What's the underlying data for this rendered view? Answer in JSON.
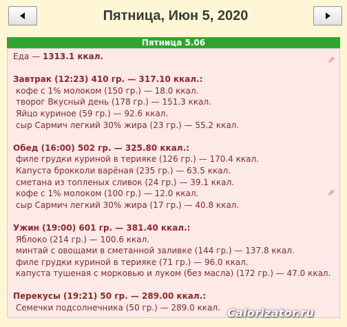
{
  "header": {
    "prev_icon": "left-arrow-icon",
    "next_icon": "right-arrow-icon",
    "title": "Пятница, Июн 5, 2020"
  },
  "day_header": {
    "label": "Пятница 5.06"
  },
  "summary": {
    "label": "Еда — ",
    "value": "1313.1 ккал."
  },
  "meals": [
    {
      "title": "Завтрак (12:23) 410 гр. — 317.10 ккал.:",
      "items": [
        "кофе с 1% молоком (150 гр.) — 18.0 ккал.",
        "творог Вкусный день (178 гр.) — 151.3 ккал.",
        "Яйцо куриное (59 гр.) — 92.6 ккал.",
        "сыр Сармич легкий 30% жира (23 гр.) — 55.2 ккал."
      ]
    },
    {
      "title": "Обед (16:00) 502 гр. — 325.80 ккал.:",
      "items": [
        "филе грудки куриной в терияке (126 гр.) — 170.4 ккал.",
        "Капуста брокколи варёная (235 гр.) — 63.5 ккал.",
        "сметана из топленых сливок (24 гр.) — 39.1 ккал.",
        "кофе с 1% молоком (100 гр.) — 12.0 ккал.",
        "сыр Сармич легкий 30% жира (17 гр.) — 40.8 ккал."
      ]
    },
    {
      "title": "Ужин (19:00) 601 гр. — 381.40 ккал.:",
      "items": [
        "Яблоко (214 гр.) — 100.6 ккал.",
        "минтай с овощами в сметанной заливке (144 гр.) — 137.8 ккал.",
        "филе грудки куриной в терияке (71 гр.) — 96.0 ккал.",
        "капуста тушеная с морковью и луком (без масла) (172 гр.) — 47.0 ккал."
      ]
    },
    {
      "title": "Перекусы (19:21) 50 гр. — 289.00 ккал.:",
      "items": [
        "Семечки подсолнечника (50 гр.) — 289.0 ккал."
      ]
    }
  ],
  "edit_icons": [
    "pencil-icon",
    "pencil-icon"
  ],
  "watermark": {
    "text": "Calorizator.ru"
  }
}
